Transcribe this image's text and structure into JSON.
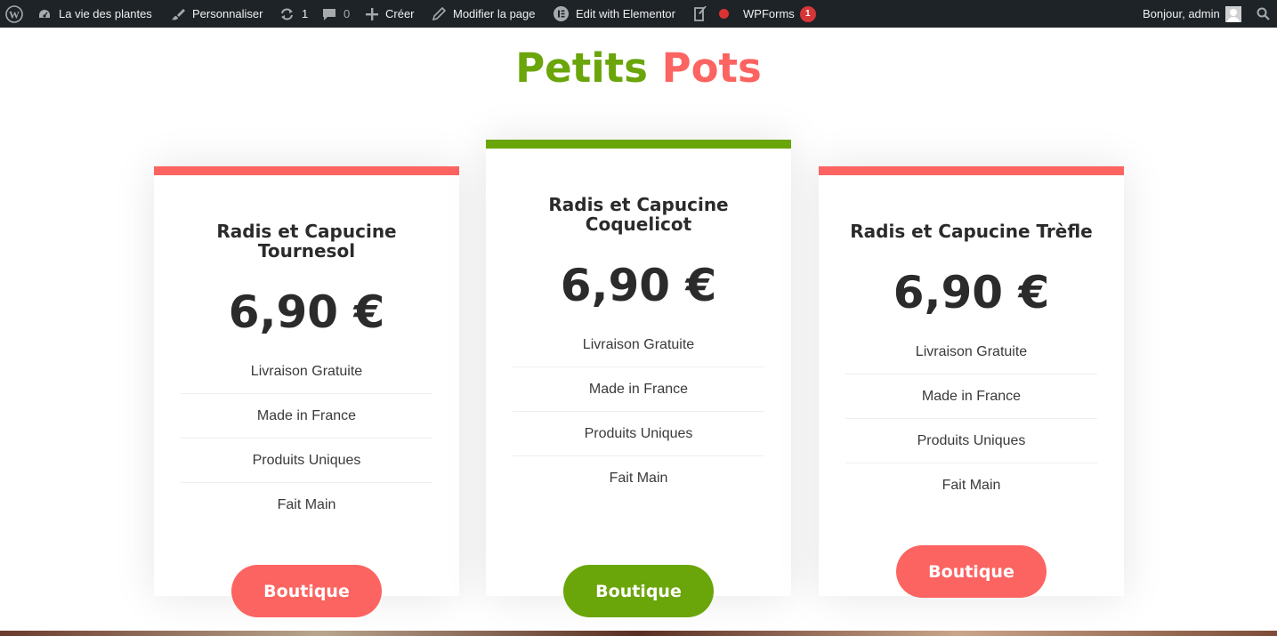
{
  "adminbar": {
    "items": [
      {
        "icon": "wordpress-logo-icon",
        "label": ""
      },
      {
        "icon": "dashboard-icon",
        "label": "La vie des plantes"
      },
      {
        "icon": "brush-icon",
        "label": "Personnaliser"
      },
      {
        "icon": "updates-icon",
        "label": "1"
      },
      {
        "icon": "comment-icon",
        "label": "0"
      },
      {
        "icon": "plus-icon",
        "label": "Créer"
      },
      {
        "icon": "pencil-icon",
        "label": "Modifier la page"
      },
      {
        "icon": "elementor-icon",
        "label": "Edit with Elementor"
      },
      {
        "icon": "yoast-icon",
        "label": ""
      },
      {
        "icon": "status-dot-icon",
        "label": ""
      },
      {
        "icon": "",
        "label": "WPForms",
        "badge": "1"
      }
    ],
    "greeting": "Bonjour, admin"
  },
  "title": {
    "part1": "Petits",
    "part2": "Pots"
  },
  "colors": {
    "green": "#6aa50a",
    "red": "#fc6461",
    "admin_bg": "#1d2327"
  },
  "cards": [
    {
      "name": "Radis et Capucine Tournesol",
      "price": "6,90 €",
      "features": [
        "Livraison Gratuite",
        "Made in France",
        "Produits Uniques",
        "Fait Main"
      ],
      "button": "Boutique"
    },
    {
      "name": "Radis et Capucine Coquelicot",
      "price": "6,90 €",
      "features": [
        "Livraison Gratuite",
        "Made in France",
        "Produits Uniques",
        "Fait Main"
      ],
      "button": "Boutique"
    },
    {
      "name": "Radis et Capucine Trèfle",
      "price": "6,90 €",
      "features": [
        "Livraison Gratuite",
        "Made in France",
        "Produits Uniques",
        "Fait Main"
      ],
      "button": "Boutique"
    }
  ]
}
